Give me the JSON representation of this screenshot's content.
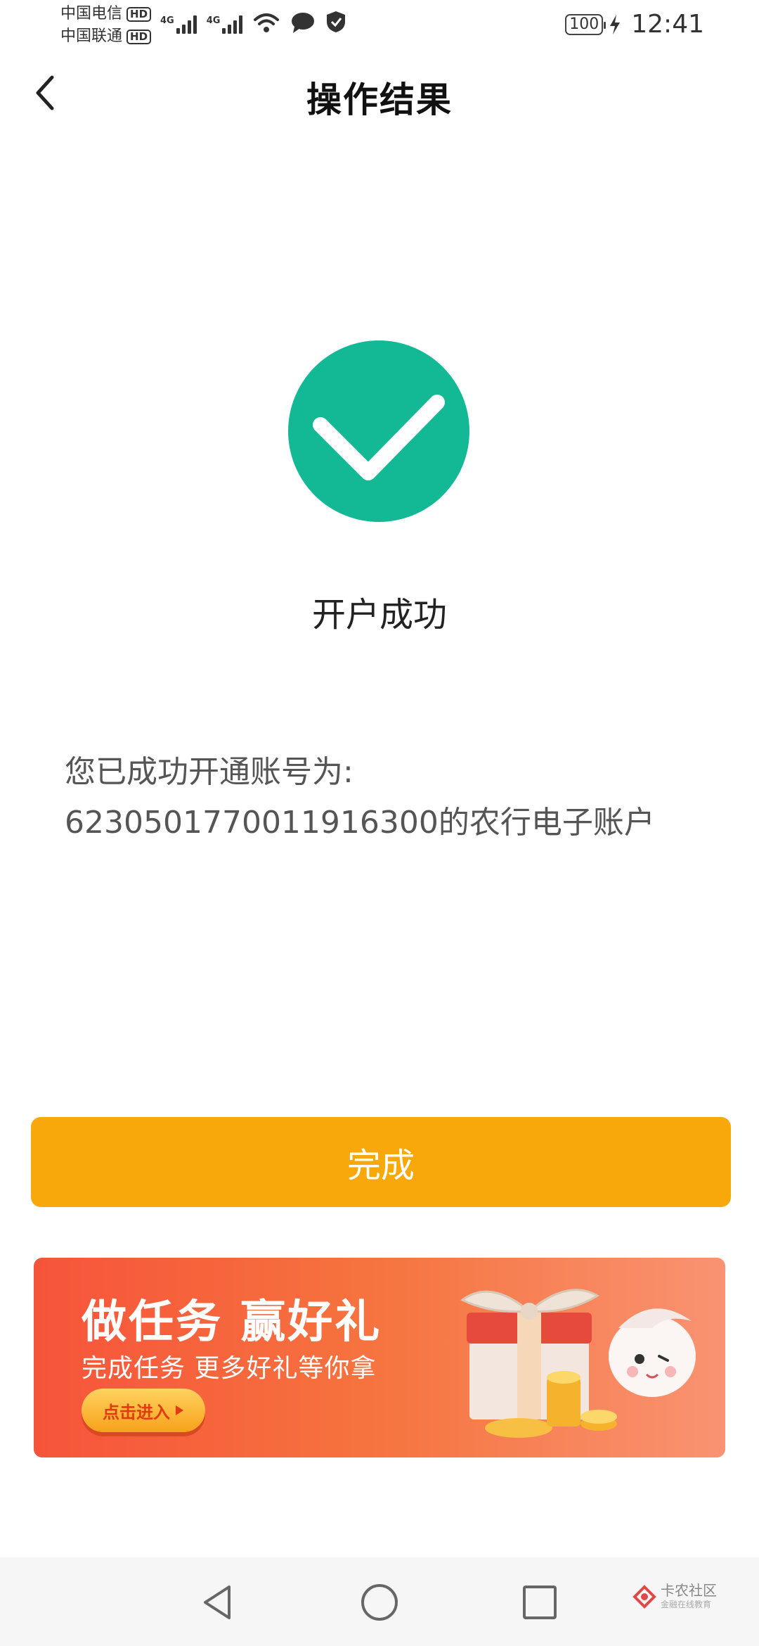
{
  "status_bar": {
    "carrier1": "中国电信",
    "carrier2": "中国联通",
    "hd_label": "HD",
    "network_label": "4G",
    "battery": "100",
    "time": "12:41"
  },
  "nav": {
    "title": "操作结果"
  },
  "result": {
    "status": "开户成功",
    "message_line1": "您已成功开通账号为:",
    "message_line2": "6230501770011916300的农行电子账户"
  },
  "done_button": {
    "label": "完成"
  },
  "promo": {
    "title": "做任务 赢好礼",
    "subtitle": "完成任务 更多好礼等你拿",
    "button_label": "点击进入"
  },
  "watermark": {
    "name": "卡农社区",
    "sub": "金融在线教育"
  },
  "colors": {
    "success": "#13b995",
    "primary_button": "#f8a80a",
    "promo_start": "#f6543a",
    "promo_end": "#f99372"
  }
}
